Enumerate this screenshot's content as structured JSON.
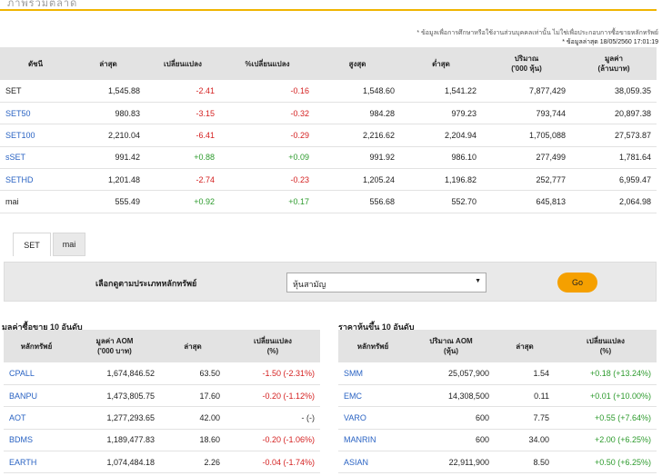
{
  "page": {
    "title": "ภาพรวมตลาด",
    "disclaimer": "* ข้อมูลเพื่อการศึกษาหรือใช้งานส่วนบุคคลเท่านั้น ไม่ใช่เพื่อประกอบการซื้อขายหลักทรัพย์",
    "updated": "* ข้อมูลล่าสุด 18/05/2560 17:01:19"
  },
  "colors": {
    "accent": "#f0b400",
    "negative": "#d41f1f",
    "positive": "#2c9a2c",
    "link": "#2a63c3",
    "button": "#f5a000"
  },
  "index_table": {
    "headers": [
      "ดัชนี",
      "ล่าสุด",
      "เปลี่ยนแปลง",
      "%เปลี่ยนแปลง",
      "สูงสุด",
      "ต่ำสุด",
      "ปริมาณ\n('000 หุ้น)",
      "มูลค่า\n(ล้านบาท)"
    ],
    "rows": [
      {
        "name": "SET",
        "last": "1,545.88",
        "chg": "-2.41",
        "pct": "-0.16",
        "high": "1,548.60",
        "low": "1,541.22",
        "vol": "7,877,429",
        "val": "38,059.35",
        "dir": "neg",
        "link": false
      },
      {
        "name": "SET50",
        "last": "980.83",
        "chg": "-3.15",
        "pct": "-0.32",
        "high": "984.28",
        "low": "979.23",
        "vol": "793,744",
        "val": "20,897.38",
        "dir": "neg",
        "link": true
      },
      {
        "name": "SET100",
        "last": "2,210.04",
        "chg": "-6.41",
        "pct": "-0.29",
        "high": "2,216.62",
        "low": "2,204.94",
        "vol": "1,705,088",
        "val": "27,573.87",
        "dir": "neg",
        "link": true
      },
      {
        "name": "sSET",
        "last": "991.42",
        "chg": "+0.88",
        "pct": "+0.09",
        "high": "991.92",
        "low": "986.10",
        "vol": "277,499",
        "val": "1,781.64",
        "dir": "pos",
        "link": true
      },
      {
        "name": "SETHD",
        "last": "1,201.48",
        "chg": "-2.74",
        "pct": "-0.23",
        "high": "1,205.24",
        "low": "1,196.82",
        "vol": "252,777",
        "val": "6,959.47",
        "dir": "neg",
        "link": true
      },
      {
        "name": "mai",
        "last": "555.49",
        "chg": "+0.92",
        "pct": "+0.17",
        "high": "556.68",
        "low": "552.70",
        "vol": "645,813",
        "val": "2,064.98",
        "dir": "pos",
        "link": false
      }
    ]
  },
  "tabs": {
    "set": "SET",
    "mai": "mai"
  },
  "filter": {
    "label": "เลือกดูตามประเภทหลักทรัพย์",
    "selected": "หุ้นสามัญ",
    "go": "Go"
  },
  "aom": {
    "title": "มูลค่าซื้อขาย 10 อันดับ",
    "headers": [
      "หลักทรัพย์",
      "มูลค่า AOM\n('000 บาท)",
      "ล่าสุด",
      "เปลี่ยนแปลง\n(%)"
    ],
    "rows": [
      {
        "sym": "CPALL",
        "value": "1,674,846.52",
        "last": "63.50",
        "chg": "-1.50 (-2.31%)",
        "dir": "neg"
      },
      {
        "sym": "BANPU",
        "value": "1,473,805.75",
        "last": "17.60",
        "chg": "-0.20 (-1.12%)",
        "dir": "neg"
      },
      {
        "sym": "AOT",
        "value": "1,277,293.65",
        "last": "42.00",
        "chg": "- (-)",
        "dir": "neu"
      },
      {
        "sym": "BDMS",
        "value": "1,189,477.83",
        "last": "18.60",
        "chg": "-0.20 (-1.06%)",
        "dir": "neg"
      },
      {
        "sym": "EARTH",
        "value": "1,074,484.18",
        "last": "2.26",
        "chg": "-0.04 (-1.74%)",
        "dir": "neg"
      }
    ]
  },
  "vol": {
    "title": "ราคาหุ้นขึ้น 10 อันดับ",
    "headers": [
      "หลักทรัพย์",
      "ปริมาณ AOM\n(หุ้น)",
      "ล่าสุด",
      "เปลี่ยนแปลง\n(%)"
    ],
    "rows": [
      {
        "sym": "SMM",
        "value": "25,057,900",
        "last": "1.54",
        "chg": "+0.18 (+13.24%)",
        "dir": "pos"
      },
      {
        "sym": "EMC",
        "value": "14,308,500",
        "last": "0.11",
        "chg": "+0.01 (+10.00%)",
        "dir": "pos"
      },
      {
        "sym": "VARO",
        "value": "600",
        "last": "7.75",
        "chg": "+0.55 (+7.64%)",
        "dir": "pos"
      },
      {
        "sym": "MANRIN",
        "value": "600",
        "last": "34.00",
        "chg": "+2.00 (+6.25%)",
        "dir": "pos"
      },
      {
        "sym": "ASIAN",
        "value": "22,911,900",
        "last": "8.50",
        "chg": "+0.50 (+6.25%)",
        "dir": "pos"
      }
    ]
  }
}
